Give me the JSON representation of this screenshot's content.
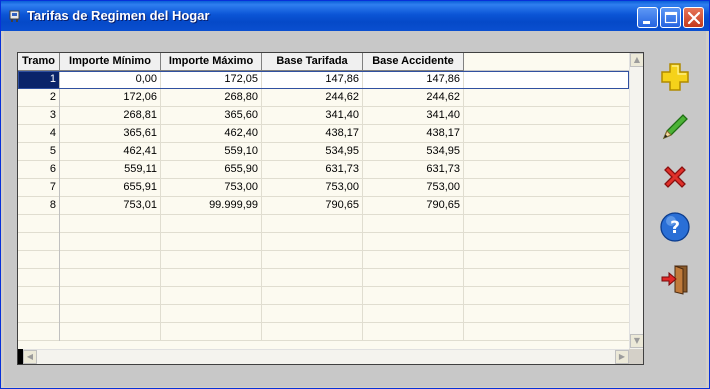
{
  "window": {
    "title": "Tarifas de Regimen del Hogar",
    "controls": [
      "minimize-icon",
      "maximize-icon",
      "close-icon"
    ]
  },
  "table": {
    "columns": [
      "Tramo",
      "Importe Mínimo",
      "Importe Máximo",
      "Base Tarifada",
      "Base Accidente"
    ],
    "rows": [
      [
        "1",
        "0,00",
        "172,05",
        "147,86",
        "147,86"
      ],
      [
        "2",
        "172,06",
        "268,80",
        "244,62",
        "244,62"
      ],
      [
        "3",
        "268,81",
        "365,60",
        "341,40",
        "341,40"
      ],
      [
        "4",
        "365,61",
        "462,40",
        "438,17",
        "438,17"
      ],
      [
        "5",
        "462,41",
        "559,10",
        "534,95",
        "534,95"
      ],
      [
        "6",
        "559,11",
        "655,90",
        "631,73",
        "631,73"
      ],
      [
        "7",
        "655,91",
        "753,00",
        "753,00",
        "753,00"
      ],
      [
        "8",
        "753,01",
        "99.999,99",
        "790,65",
        "790,65"
      ]
    ],
    "selected_row": 0
  },
  "toolbar": {
    "buttons": [
      "add-icon",
      "edit-icon",
      "delete-icon",
      "help-icon",
      "exit-icon"
    ]
  },
  "colors": {
    "title_bar": "#0b55d6",
    "grid_background": "#fcfaf0",
    "selection": "#0a246a"
  }
}
